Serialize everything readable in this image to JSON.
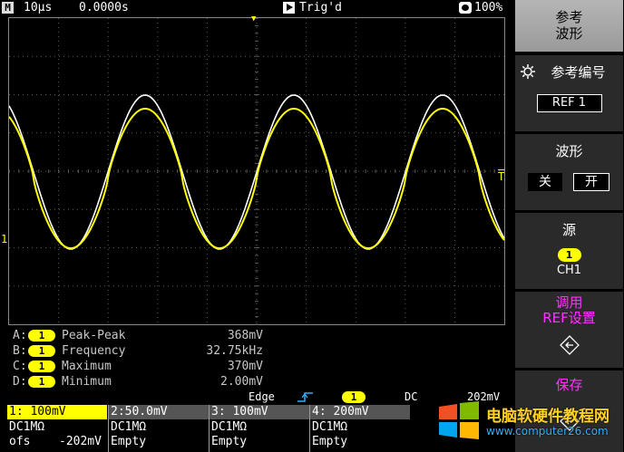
{
  "topbar": {
    "mode_icon": "M",
    "timebase": "10µs",
    "delay": "0.0000s",
    "trigger_status": "Trig'd",
    "battery": "100%"
  },
  "screen": {
    "channel1_marker": "1",
    "trigger_level_marker": "T",
    "trigger_position_marker": "▼"
  },
  "measurements": [
    {
      "slot": "A:",
      "channel": "1",
      "name": "Peak-Peak",
      "value": "368mV"
    },
    {
      "slot": "B:",
      "channel": "1",
      "name": "Frequency",
      "value": "32.75kHz"
    },
    {
      "slot": "C:",
      "channel": "1",
      "name": "Maximum",
      "value": "370mV"
    },
    {
      "slot": "D:",
      "channel": "1",
      "name": "Minimum",
      "value": "2.00mV"
    }
  ],
  "trigger": {
    "type": "Edge",
    "slope_icon": "rising-edge-icon",
    "source": "1",
    "coupling": "DC",
    "level": "202mV"
  },
  "channels": [
    {
      "header": "1: 100mV",
      "coupling": "DC1MΩ",
      "line3_label": "ofs",
      "line3_value": "-202mV"
    },
    {
      "header": "2:50.0mV",
      "coupling": "DC1MΩ",
      "line3_label": "Empty",
      "line3_value": ""
    },
    {
      "header": "3: 100mV",
      "coupling": "DC1MΩ",
      "line3_label": "Empty",
      "line3_value": ""
    },
    {
      "header": "4: 200mV",
      "coupling": "DC1MΩ",
      "line3_label": "Empty",
      "line3_value": ""
    }
  ],
  "menu": {
    "title_line1": "参考",
    "title_line2": "波形",
    "ref_number_label": "参考编号",
    "ref_number_value": "REF 1",
    "waveform_label": "波形",
    "waveform_off": "关",
    "waveform_on": "开",
    "source_label": "源",
    "source_badge": "1",
    "source_name": "CH1",
    "recall_line1": "调用",
    "recall_line2": "REF设置",
    "save_label": "保存"
  },
  "watermark": {
    "title": "电脑软硬件教程网",
    "url": "www.computer26.com"
  },
  "colors": {
    "ch1": "#ffff00",
    "reference": "#ffffff",
    "grid": "#5a5a5a",
    "menu_accent": "#ff33ff"
  }
}
